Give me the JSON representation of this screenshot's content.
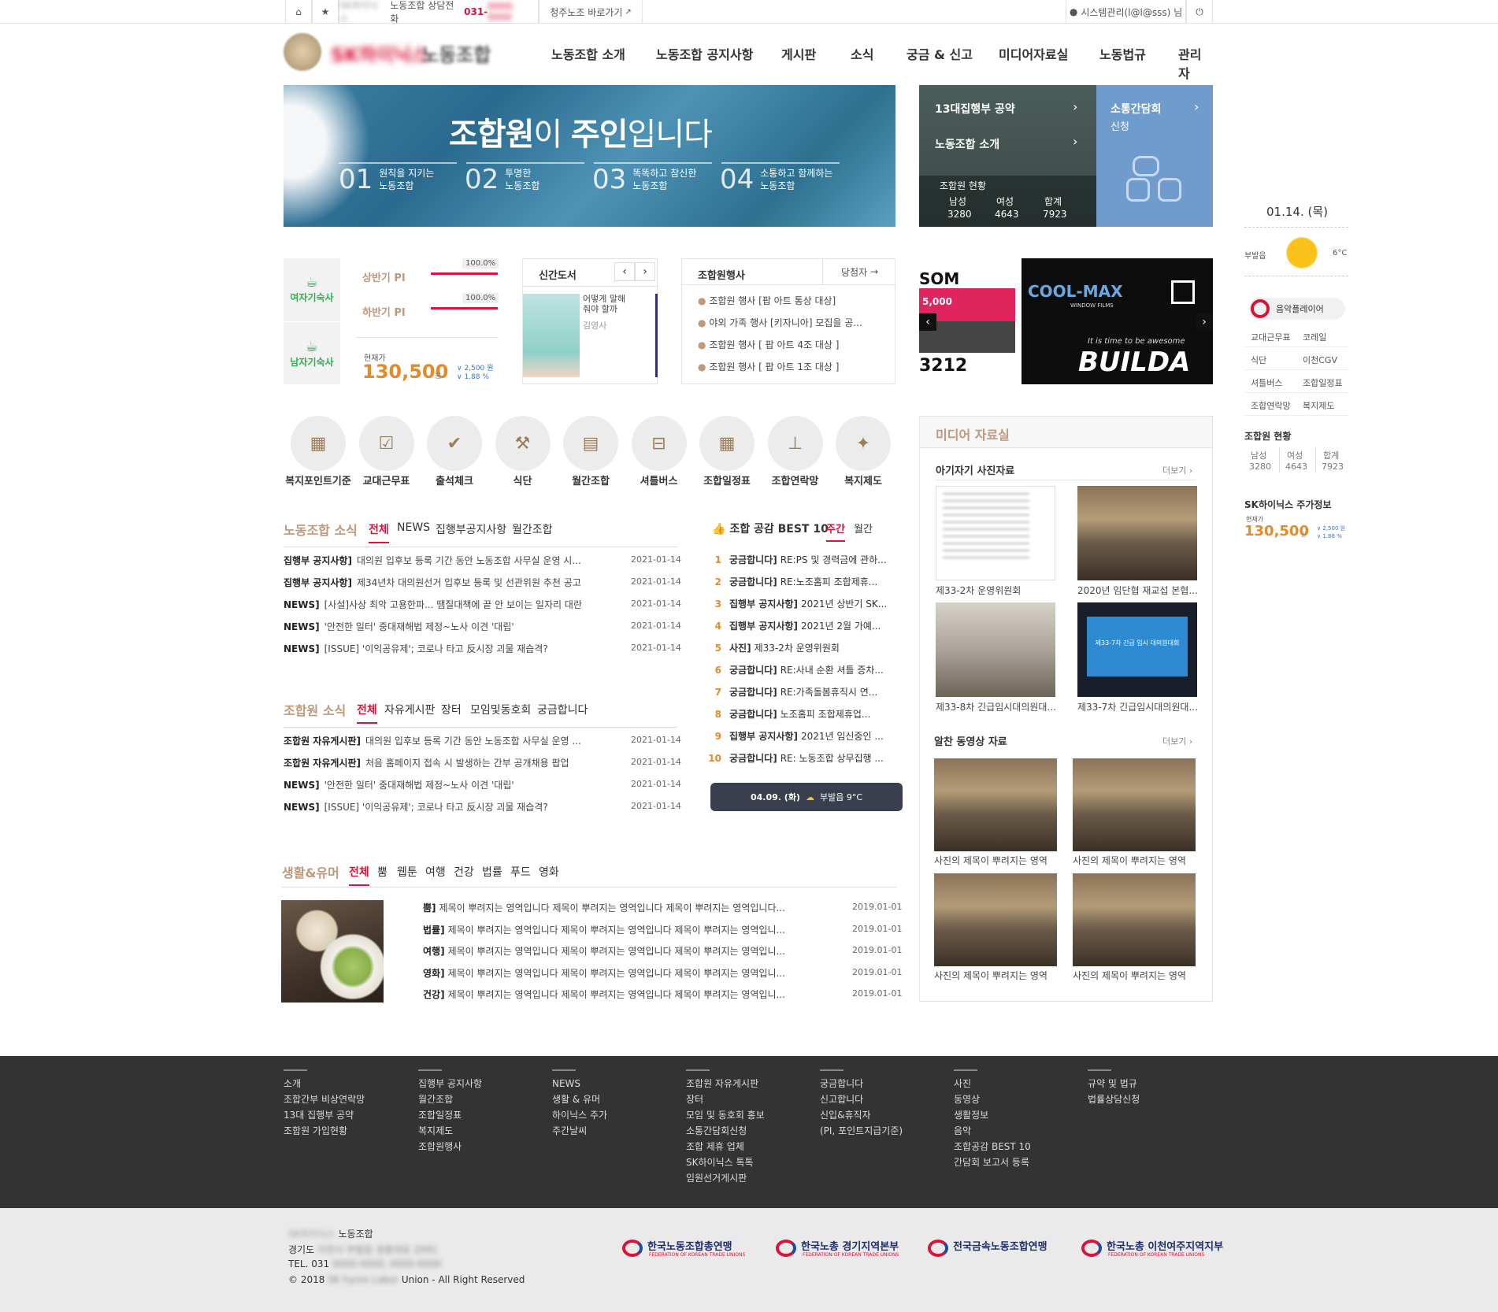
{
  "topbar": {
    "home_icon": "home-icon",
    "star_icon": "star-icon",
    "hotline_label": "노동조합 상담전화",
    "hotline_num": "031-",
    "cheongju_link": "청주노조 바로가기",
    "user_label": "시스템관리(l@l@sss) 님",
    "power_icon": "power-icon"
  },
  "logo": {
    "text": "노동조합"
  },
  "nav": [
    "노동조합 소개",
    "노동조합 공지사항",
    "게시판",
    "소식",
    "궁금 & 신고",
    "미디어자료실",
    "노동법규",
    "관리자"
  ],
  "hero": {
    "title_bold1": "조합원",
    "title_thin1": "이 ",
    "title_bold2": "주인",
    "title_thin2": "입니다",
    "steps": [
      {
        "num": "01",
        "l1": "원칙을 지키는",
        "l2": "노동조합"
      },
      {
        "num": "02",
        "l1": "투명한",
        "l2": "노동조합"
      },
      {
        "num": "03",
        "l1": "똑똑하고 참신한",
        "l2": "노동조합"
      },
      {
        "num": "04",
        "l1": "소통하고 함께하는",
        "l2": "노동조합"
      }
    ]
  },
  "side_panel": {
    "pledge": "13대집행부 공약",
    "intro": "노동조합 소개",
    "status_title": "조합원 현황",
    "cols": [
      "남성",
      "여성",
      "합계"
    ],
    "vals": [
      "3280",
      "4643",
      "7923"
    ],
    "talk_title": "소통간담회",
    "talk_sub": "신청"
  },
  "tech": {
    "female": "여자기숙사",
    "male": "남자기숙사"
  },
  "pi": {
    "first_label": "상반기 PI",
    "first_pct": "100.0%",
    "second_label": "하반기 PI",
    "second_pct": "100.0%",
    "price_label": "현재가",
    "price": "130,500",
    "won": "원",
    "change": "2,500",
    "change_unit": "원",
    "pct": "1.88",
    "pct_unit": "%"
  },
  "books": {
    "title": "신간도서",
    "book_title": "어떻게 말해줘야 할까",
    "author": "김영사"
  },
  "events": {
    "title": "조합원행사",
    "more": "당첨자",
    "items": [
      "조합원 행사 [팝 아트 통상 대상]",
      "야외 가족 행사 [키자니아] 모집을 공...",
      "조합원 행사 [ 팝 아트 4조 대상 ]",
      "조합원 행사 [ 팝 아트 1조 대상 ]"
    ]
  },
  "banner": {
    "left1": "SOM",
    "left2": "5,000",
    "left3": "3212",
    "coolmax": "COOL-MAX",
    "coolmax_sub": "WINDOW FILMS",
    "tag": "It is time to be awesome",
    "build": "BUILDA"
  },
  "quick": [
    {
      "label": "복지포인트기준",
      "icon": "calculator-icon",
      "g": "▦"
    },
    {
      "label": "교대근무표",
      "icon": "calendar-check-icon",
      "g": "☑"
    },
    {
      "label": "출석체크",
      "icon": "check-icon",
      "g": "✔"
    },
    {
      "label": "식단",
      "icon": "wrench-icon",
      "g": "⚒"
    },
    {
      "label": "월간조합",
      "icon": "book-icon",
      "g": "▤"
    },
    {
      "label": "셔틀버스",
      "icon": "bus-icon",
      "g": "⊟"
    },
    {
      "label": "조합일정표",
      "icon": "calendar-icon",
      "g": "▦"
    },
    {
      "label": "조합연락망",
      "icon": "sitemap-icon",
      "g": "⊥"
    },
    {
      "label": "복지제도",
      "icon": "gift-icon",
      "g": "✦"
    }
  ],
  "union_news": {
    "title": "노동조합 소식",
    "tabs": [
      "전체",
      "NEWS",
      "집행부공지사항",
      "월간조합"
    ],
    "rows": [
      {
        "cat": "집행부 공지사항]",
        "text": "대의원 입후보 등록 기간 동안 노동조합 사무실 운영 시...",
        "date": "2021-01-14"
      },
      {
        "cat": "집행부 공지사항]",
        "text": "제34년차 대의원선거 입후보 등록 및 선관위원 추천 공고",
        "date": "2021-01-14"
      },
      {
        "cat": "NEWS]",
        "text": "[사설]사상 최악 고용한파... 땜질대책에 끝 안 보이는 일자리 대란",
        "date": "2021-01-14"
      },
      {
        "cat": "NEWS]",
        "text": "'안전한 일터' 중대재해법 제정~노사 이견 '대립'",
        "date": "2021-01-14"
      },
      {
        "cat": "NEWS]",
        "text": "[ISSUE] '이익공유제'; 코로나 타고 反시장 괴물 재습격?",
        "date": "2021-01-14"
      }
    ]
  },
  "member_news": {
    "title": "조합원 소식",
    "tabs": [
      "전체",
      "자유게시판",
      "장터",
      "모임및동호회",
      "궁금합니다"
    ],
    "rows": [
      {
        "cat": "조합원 자유게시판]",
        "text": "대의원 입후보 등록 기간 동안 노동조합 사무실 운영 ...",
        "date": "2021-01-14"
      },
      {
        "cat": "조합원 자유게시판]",
        "text": "처음 홈페이지 접속 시 발생하는 간부 공개채용 팝업",
        "date": "2021-01-14"
      },
      {
        "cat": "NEWS]",
        "text": "'안전한 일터' 중대재해법 제정~노사 이견 '대립'",
        "date": "2021-01-14"
      },
      {
        "cat": "NEWS]",
        "text": "[ISSUE] '이익공유제'; 코로나 타고 反시장 괴물 재습격?",
        "date": "2021-01-14"
      }
    ]
  },
  "best": {
    "title": "조합 공감 BEST 10",
    "tabs": [
      "주간",
      "월간"
    ],
    "items": [
      {
        "n": "1",
        "cat": "궁금합니다]",
        "text": "RE:PS 및 경력금에 관하..."
      },
      {
        "n": "2",
        "cat": "궁금합니다]",
        "text": "RE:노조홈피 조합제휴..."
      },
      {
        "n": "3",
        "cat": "집행부 공지사항]",
        "text": "2021년 상반기 SK..."
      },
      {
        "n": "4",
        "cat": "집행부 공지사항]",
        "text": "2021년 2월 가예..."
      },
      {
        "n": "5",
        "cat": "사진]",
        "text": "제33-2차 운영위원회"
      },
      {
        "n": "6",
        "cat": "궁금합니다]",
        "text": "RE:사내 순환 셔틀 증차..."
      },
      {
        "n": "7",
        "cat": "궁금합니다]",
        "text": "RE:가족돌봄휴직시 연..."
      },
      {
        "n": "8",
        "cat": "궁금합니다]",
        "text": "노조홈피 조합제휴업..."
      },
      {
        "n": "9",
        "cat": "집행부 공지사항]",
        "text": "2021년 임신중인 ..."
      },
      {
        "n": "10",
        "cat": "궁금합니다]",
        "text": "RE: 노동조합 상무집행 ..."
      }
    ],
    "weather_date": "04.09. (화)",
    "weather_text": "부발읍 9°C"
  },
  "life": {
    "title": "생활&유머",
    "tabs": [
      "전체",
      "뿜",
      "웹툰",
      "여행",
      "건강",
      "법률",
      "푸드",
      "영화"
    ],
    "rows": [
      {
        "cat": "뿜]",
        "text": "제목이 뿌려지는 영역입니다 제목이 뿌려지는 영역입니다 제목이 뿌려지는 영역입니다...",
        "date": "2019.01-01"
      },
      {
        "cat": "법률]",
        "text": "제목이 뿌려지는 영역입니다 제목이 뿌려지는 영역입니다 제목이 뿌려지는 영역입니...",
        "date": "2019.01-01"
      },
      {
        "cat": "여행]",
        "text": "제목이 뿌려지는 영역입니다 제목이 뿌려지는 영역입니다 제목이 뿌려지는 영역입니...",
        "date": "2019.01-01"
      },
      {
        "cat": "영화]",
        "text": "제목이 뿌려지는 영역입니다 제목이 뿌려지는 영역입니다 제목이 뿌려지는 영역입니...",
        "date": "2019.01-01"
      },
      {
        "cat": "건강]",
        "text": "제목이 뿌려지는 영역입니다 제목이 뿌려지는 영역입니다 제목이 뿌려지는 영역입니...",
        "date": "2019.01-01"
      }
    ]
  },
  "media": {
    "title": "미디어 자료실",
    "photo_title": "아기자기 사진자료",
    "more": "더보기",
    "video_title": "알찬 동영상 자료",
    "photos": [
      "제33-2차 운영위원회",
      "2020년 임단협 재교섭 본협...",
      "제33-8차 긴급임시대의원대...",
      "제33-7차 긴급임시대의원대..."
    ],
    "photo_overlay": "제33-7차 긴급 임시 대의원대회",
    "videos": [
      "사진의 제목이 뿌려지는 영역",
      "사진의 제목이 뿌려지는 영역",
      "사진의 제목이 뿌려지는 영역",
      "사진의 제목이 뿌려지는 영역"
    ]
  },
  "right": {
    "date": "01.14. (목)",
    "loc": "부발읍",
    "temp": "6°C",
    "music": "음악플레이어",
    "links": [
      "교대근무표",
      "코레일",
      "식단",
      "이천CGV",
      "셔틀버스",
      "조합일정표",
      "조합연락망",
      "복지제도"
    ],
    "status_title": "조합원 현황",
    "cols": [
      "남성",
      "여성",
      "합계"
    ],
    "vals": [
      "3280",
      "4643",
      "7923"
    ],
    "stock_title": "SK하이닉스 주가정보",
    "price_label": "현재가",
    "price": "130,500",
    "won": "원",
    "change": "2,500",
    "change_unit": "원",
    "pct": "1.88",
    "pct_unit": "%"
  },
  "footer": {
    "cols": [
      [
        "소개",
        "조합간부 비상연락망",
        "13대 집행부 공약",
        "조합원 가입현황"
      ],
      [
        "집행부 공지사항",
        "월간조합",
        "조합일정표",
        "복지제도",
        "조합원행사"
      ],
      [
        "NEWS",
        "생활 & 유머",
        "하이닉스 주가",
        "주간날씨"
      ],
      [
        "조합원 자유게시판",
        "장터",
        "모임 및 동호회 홍보",
        "소통간담회신청",
        "조합 제휴 업체",
        "SK하이닉스 톡톡",
        "임원선거게시판"
      ],
      [
        "궁금합니다",
        "신고합니다",
        "신입&휴직자",
        "(PI, 포인트지급기준)"
      ],
      [
        "사진",
        "동영상",
        "생활정보",
        "음악",
        "조합공감 BEST 10",
        "간담회 보고서 등록"
      ],
      [
        "규약 및 법규",
        "법률상담신청"
      ]
    ],
    "org": "노동조합",
    "addr_label": "경기도",
    "tel_label": "TEL. 031",
    "copy1": "© 2018",
    "copy2": "Union - All Right Reserved",
    "partners": [
      {
        "kr": "한국노동조합총연맹",
        "en": "FEDERATION OF KOREAN TRADE UNIONS"
      },
      {
        "kr": "한국노총 경기지역본부",
        "en": "FEDERATION OF KOREAN TRADE UNIONS"
      },
      {
        "kr": "전국금속노동조합연맹",
        "en": ""
      },
      {
        "kr": "한국노총 이천여주지역지부",
        "en": "FEDERATION OF KOREAN TRADE UNIONS"
      }
    ]
  },
  "colors": {
    "accent": "#d9143a",
    "gold": "#c0987a",
    "orange": "#e38b2a",
    "footer_dark": "#333333",
    "tech_green": "#2bb24c"
  }
}
